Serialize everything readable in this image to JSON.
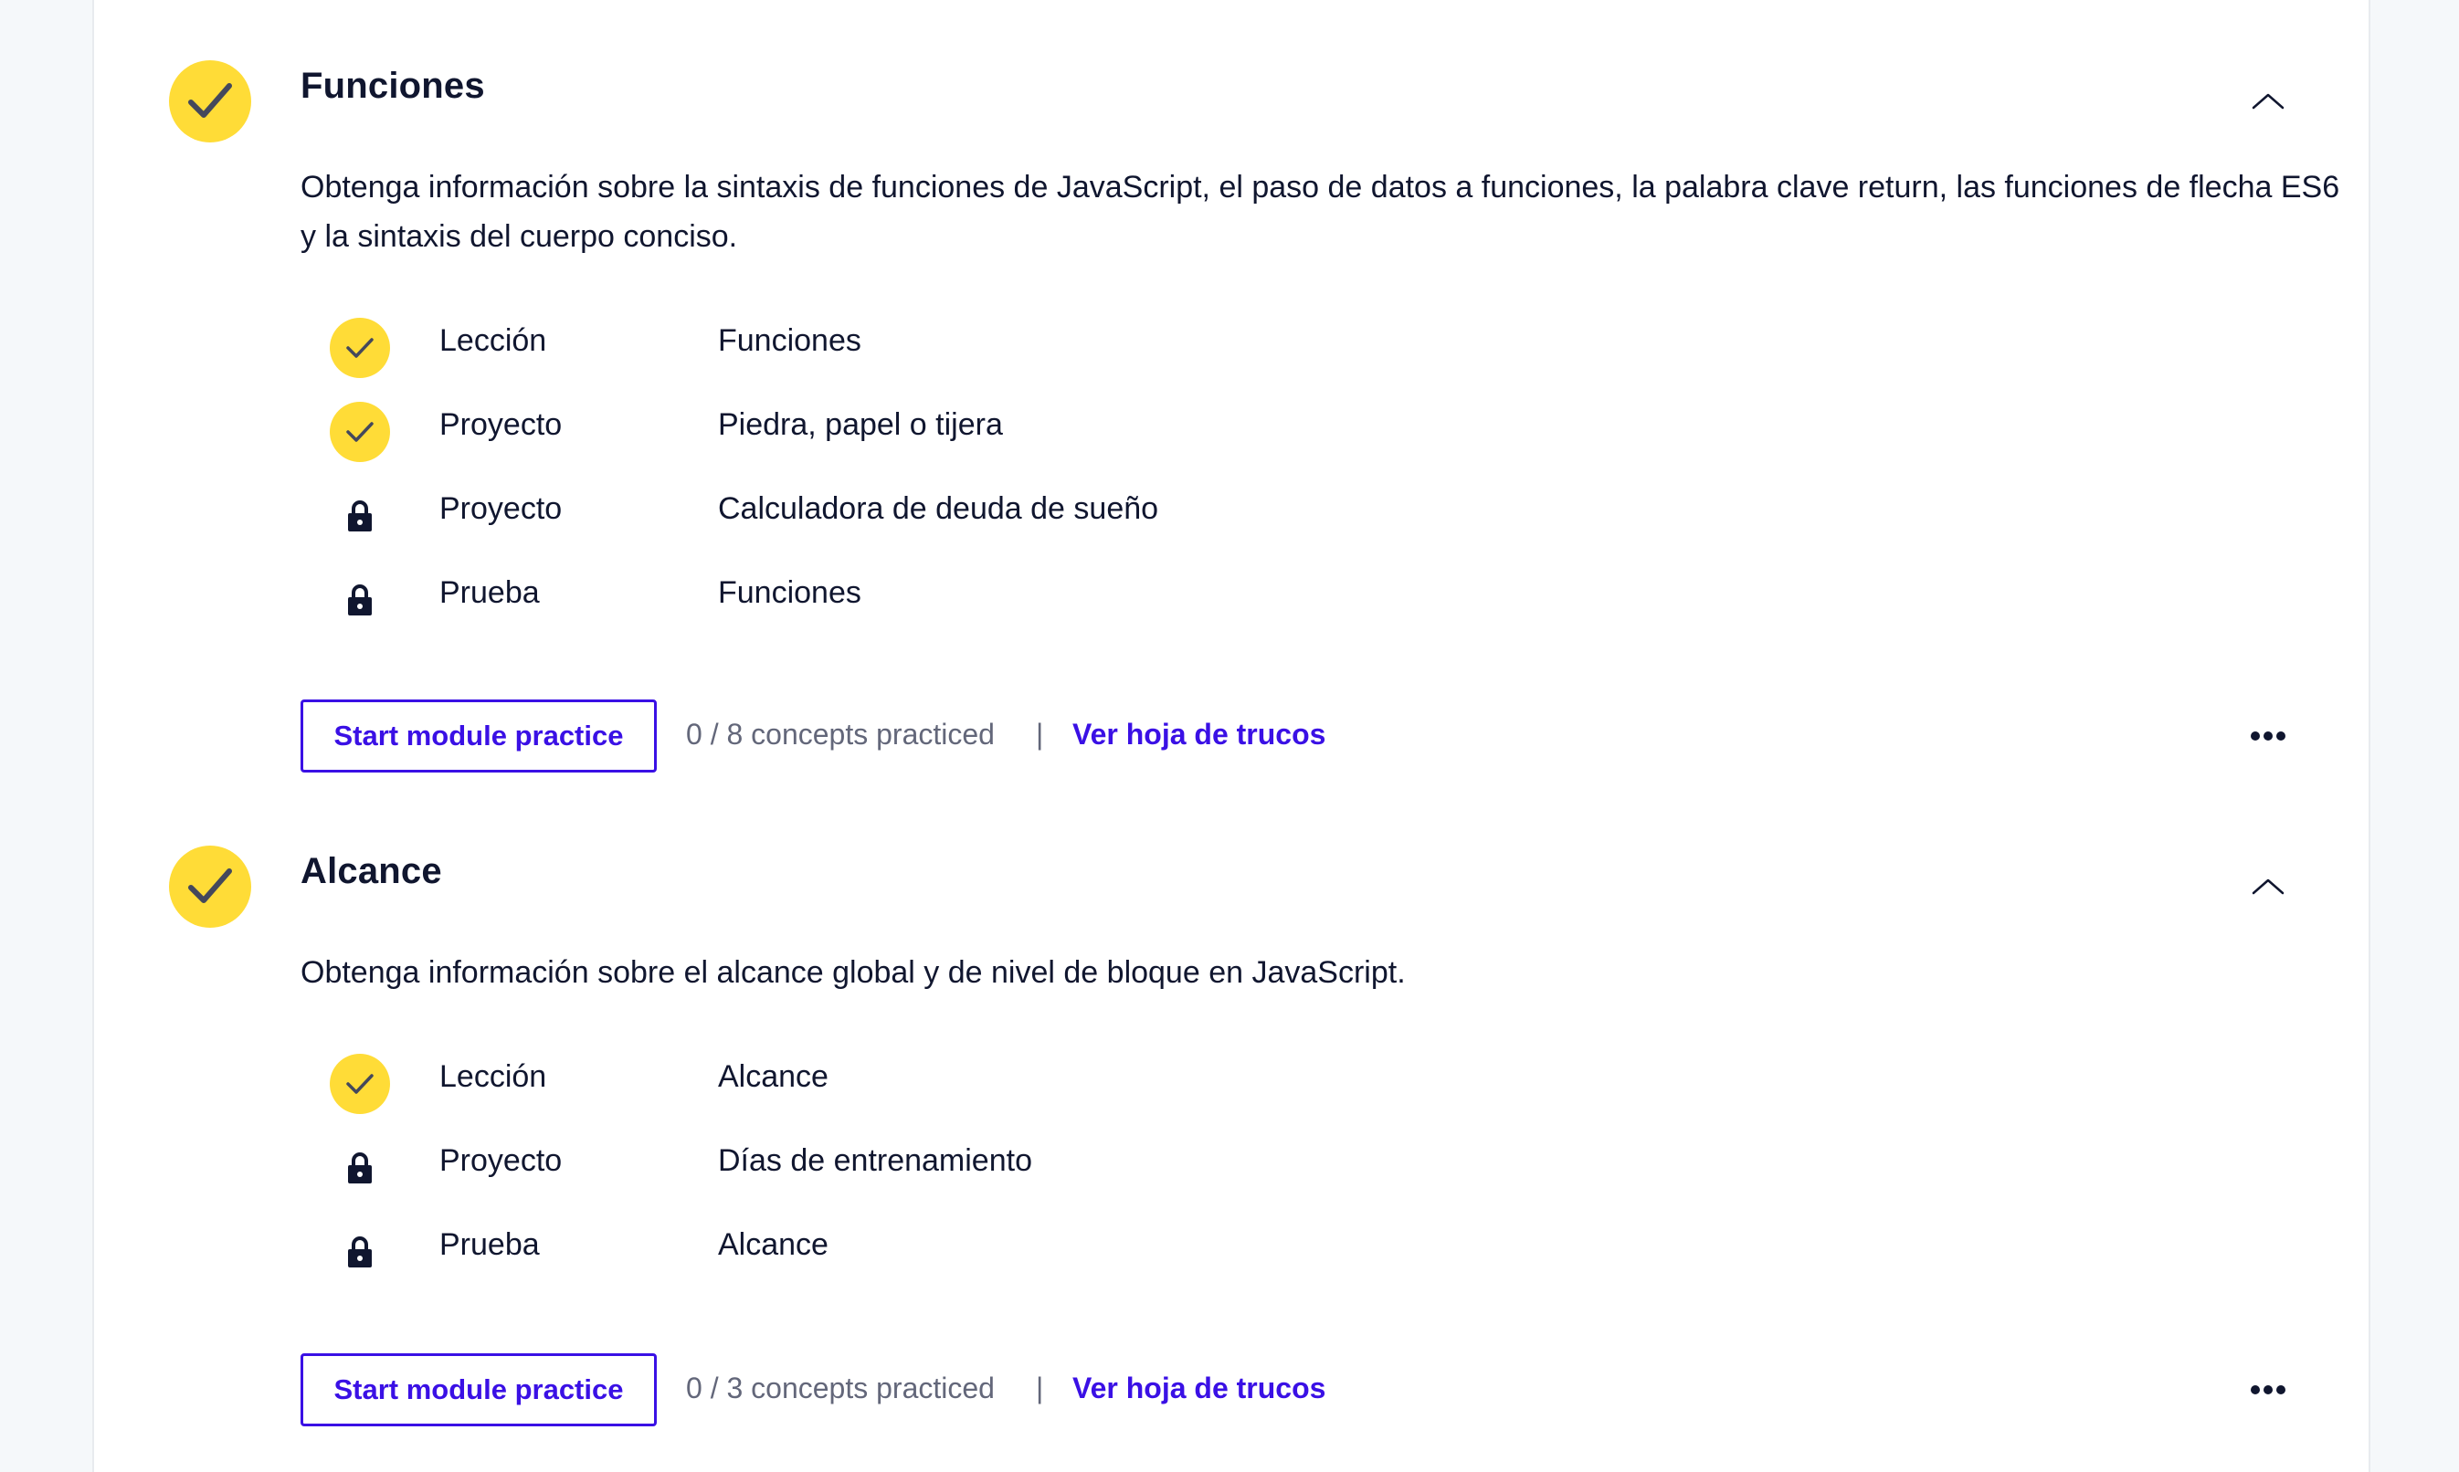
{
  "colors": {
    "accent": "#3a10e5",
    "completed": "#ffd300",
    "text": "#10162f",
    "muted": "#63677a",
    "background": "#f5f8fa"
  },
  "modules": [
    {
      "title": "Funciones",
      "status": "completed",
      "description": "Obtenga información sobre la sintaxis de funciones de JavaScript, el paso de datos a funciones, la palabra clave return, las funciones de flecha ES6 y la sintaxis del cuerpo conciso.",
      "items": [
        {
          "type": "Lección",
          "name": "Funciones",
          "state": "completed",
          "icon": "check-icon"
        },
        {
          "type": "Proyecto",
          "name": "Piedra, papel o tijera",
          "state": "completed",
          "icon": "check-icon"
        },
        {
          "type": "Proyecto",
          "name": "Calculadora de deuda de sueño",
          "state": "locked",
          "icon": "lock-icon"
        },
        {
          "type": "Prueba",
          "name": "Funciones",
          "state": "locked",
          "icon": "lock-icon"
        }
      ],
      "practice_label": "Start module practice",
      "concepts_text": "0 / 8 concepts practiced",
      "divider": "|",
      "cheatsheet_label": "Ver hoja de trucos"
    },
    {
      "title": "Alcance",
      "status": "completed",
      "description": "Obtenga información sobre el alcance global y de nivel de bloque en JavaScript.",
      "items": [
        {
          "type": "Lección",
          "name": "Alcance",
          "state": "completed",
          "icon": "check-icon"
        },
        {
          "type": "Proyecto",
          "name": "Días de entrenamiento",
          "state": "locked",
          "icon": "lock-icon"
        },
        {
          "type": "Prueba",
          "name": "Alcance",
          "state": "locked",
          "icon": "lock-icon"
        }
      ],
      "practice_label": "Start module practice",
      "concepts_text": "0 / 3 concepts practiced",
      "divider": "|",
      "cheatsheet_label": "Ver hoja de trucos"
    }
  ]
}
